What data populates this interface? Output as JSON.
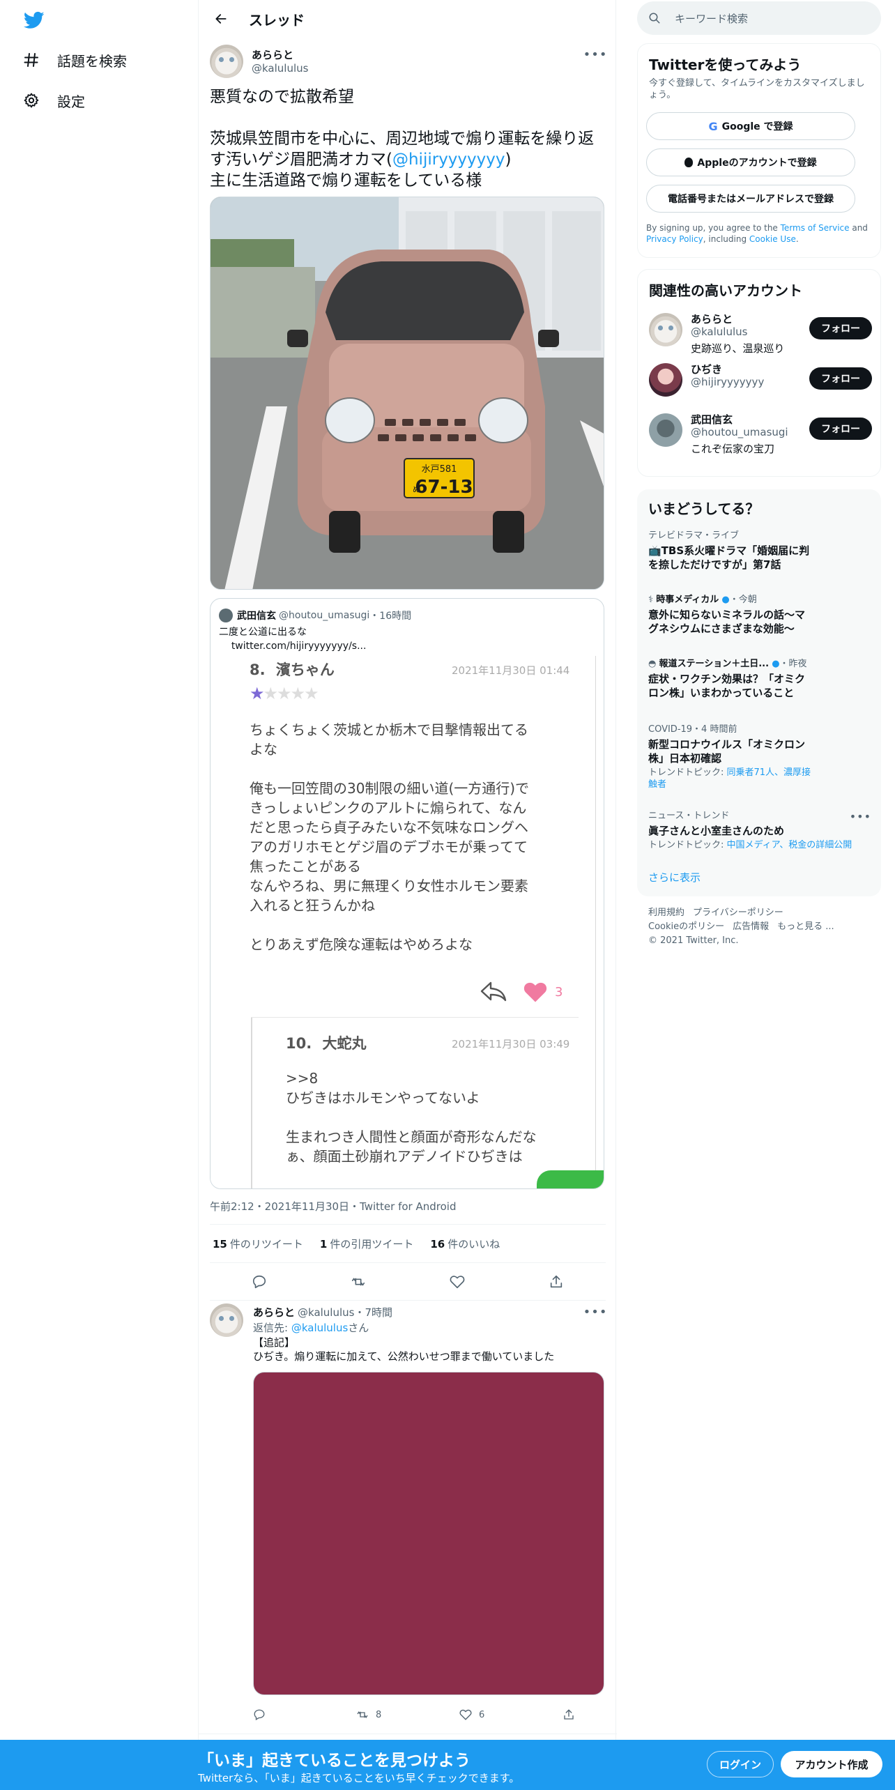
{
  "nav": {
    "logo_icon": "twitter-bird-icon",
    "explore_label": "話題を検索",
    "settings_label": "設定"
  },
  "header": {
    "title": "スレッド"
  },
  "tweet": {
    "name": "あららと",
    "handle": "@kalululus",
    "text_line1": "悪質なので拡散希望",
    "text_line2": "茨城県笠間市を中心に、周辺地域で煽り運転を繰り返す汚いゲジ眉肥満オカマ(",
    "text_mention": "@hijiryyyyyyy",
    "text_line2_end": ")",
    "text_line3": "主に生活道路で煽り運転をしている様",
    "photo": {
      "plate_top": "水戸581",
      "plate_kana": "ぬ",
      "plate_number": "67-13"
    },
    "quote": {
      "name": "武田信玄",
      "handle": "@houtou_umasugi",
      "time": "・16時間",
      "text": "二度と公道に出るな",
      "link": "twitter.com/hijiryyyyyyy/s...",
      "post1": {
        "no": "8.",
        "author": "濱ちゃん",
        "date": "2021年11月30日 01:44",
        "stars": 1,
        "p1": "ちょくちょく茨城とか栃木で目撃情報出てる",
        "p1b": "よな",
        "p2a": "俺も一回笠間の30制限の細い道(一方通行)で",
        "p2b": "きっしょいピンクのアルトに煽られて、なん",
        "p2c": "だと思ったら貞子みたいな不気味なロングヘ",
        "p2d": "アのガリホモとゲジ眉のデブホモが乗ってて",
        "p2e": "焦ったことがある",
        "p2f": "なんやろね、男に無理くり女性ホルモン要素",
        "p2g": "入れると狂うんかね",
        "p3": "とりあえず危険な運転はやめろよな",
        "likes": "3"
      },
      "post2": {
        "no": "10.",
        "author": "大蛇丸",
        "date": "2021年11月30日 03:49",
        "l1": ">>8",
        "l2": "ひぢきはホルモンやってないよ",
        "l3": "生まれつき人間性と顔面が奇形なんだな",
        "l4": "ぁ、顔面土砂崩れアデノイドひぢきは"
      }
    },
    "meta": "午前2:12・2021年11月30日・Twitter for Android",
    "retweets_count": "15",
    "retweets_label": "件のリツイート",
    "quotes_count": "1",
    "quotes_label": "件の引用ツイート",
    "likes_count": "16",
    "likes_label": "件のいいね"
  },
  "reply": {
    "name": "あららと",
    "handle": "@kalululus",
    "time": "・7時間",
    "reply_to_label": "返信先: ",
    "reply_to_handle": "@kalululus",
    "reply_to_suffix": "さん",
    "text_line1": "【追記】",
    "text_line2": "ひぢき。煽り運転に加えて、公然わいせつ罪まで働いていました",
    "retweets": "8",
    "likes": "6"
  },
  "sidebar": {
    "search_placeholder": "キーワード検索",
    "signup": {
      "title": "Twitterを使ってみよう",
      "subtitle": "今すぐ登録して、タイムラインをカスタマイズしましょう。",
      "google": "Google で登録",
      "apple": "Appleのアカウントで登録",
      "phone": "電話番号またはメールアドレスで登録",
      "legal_1": "By signing up, you agree to the ",
      "terms": "Terms of Service",
      "legal_2": " and ",
      "privacy": "Privacy Policy",
      "legal_3": ", including ",
      "cookie": "Cookie Use",
      "legal_4": "."
    },
    "related": {
      "title": "関連性の高いアカウント",
      "follow_label": "フォロー",
      "accounts": [
        {
          "name": "あららと",
          "handle": "@kalululus",
          "bio": "史跡巡り、温泉巡り"
        },
        {
          "name": "ひぢき",
          "handle": "@hijiryyyyyyy",
          "bio": ""
        },
        {
          "name": "武田信玄",
          "handle": "@houtou_umasugi",
          "bio": "これぞ伝家の宝刀"
        }
      ]
    },
    "trends": {
      "title": "いまどうしてる？",
      "items": [
        {
          "context": "テレビドラマ・ライブ",
          "title1": "📺TBS系火曜ドラマ「婚姻届に判",
          "title2": "を捺しただけですが」第7話"
        },
        {
          "context": "時事メディカル",
          "context_time": "・今朝",
          "title1": "意外に知らないミネラルの話～マ",
          "title2": "グネシウムにさまざまな効能～"
        },
        {
          "context": "報道ステーション＋土日...",
          "context_time": "・昨夜",
          "title1": "症状・ワクチン効果は？「オミク",
          "title2": "ロン株」いまわかっていること"
        },
        {
          "context": "COVID-19・4 時間前",
          "title1": "新型コロナウイルス「オミクロン",
          "title2": "株」日本初確認",
          "topic_label": "トレンドトピック: ",
          "topic1": "同乗者71人、濃厚接",
          "topic2": "触者"
        },
        {
          "context": "ニュース・トレンド",
          "title1": "眞子さんと小室圭さんのため",
          "topic_label": "トレンドトピック: ",
          "topic1": "中国メディア、税金の詳細公開"
        }
      ],
      "show_more": "さらに表示"
    },
    "footer": {
      "terms": "利用規約",
      "privacy": "プライバシーポリシー",
      "cookie": "Cookieのポリシー",
      "ads": "広告情報",
      "more": "もっと見る ...",
      "copyright": "© 2021 Twitter, Inc."
    }
  },
  "bottom": {
    "title": "「いま」起きていることを見つけよう",
    "subtitle": "Twitterなら、「いま」起きていることをいち早くチェックできます。",
    "login": "ログイン",
    "signup": "アカウント作成"
  },
  "colors": {
    "accent": "#1d9bf0",
    "text": "#0f1419",
    "muted": "#536471"
  }
}
